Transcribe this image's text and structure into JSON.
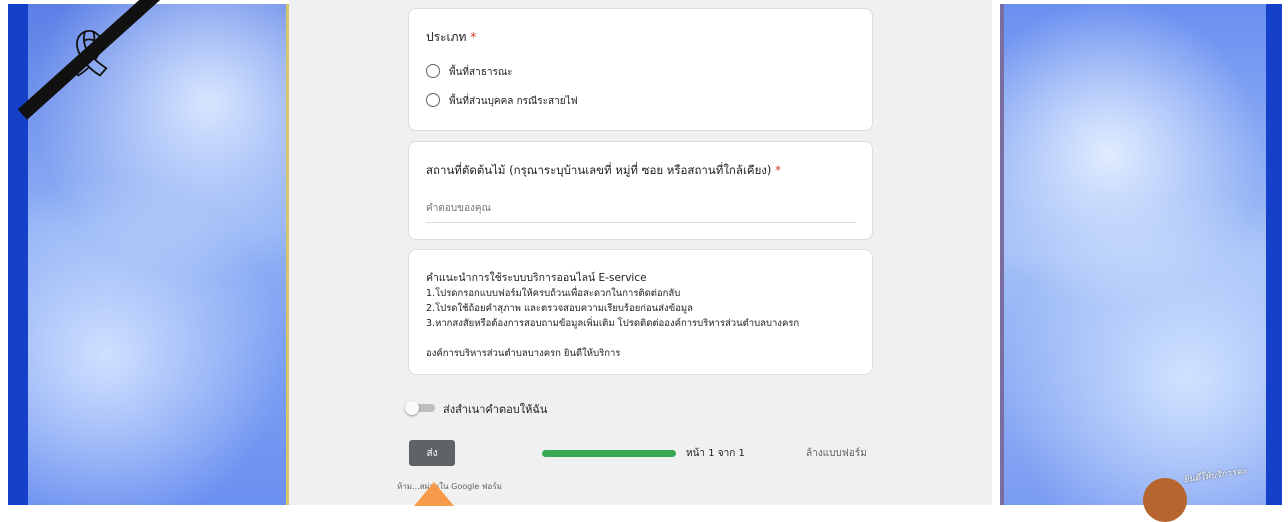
{
  "type_question": {
    "title": "ประเภท",
    "required_mark": "*",
    "options": [
      "พื้นที่สาธารณะ",
      "พื้นที่ส่วนบุคคล กรณีระสายไฟ"
    ]
  },
  "location_question": {
    "title": "สถานที่ตัดต้นไม้ (กรุณาระบุบ้านเลขที่ หมู่ที่ ซอย หรือสถานที่ใกล้เคียง)",
    "required_mark": "*",
    "placeholder": "คำตอบของคุณ"
  },
  "info_card": {
    "title": "คำแนะนำการใช้ระบบบริการออนไลน์ E-service",
    "lines": [
      "1.โปรดกรอกแบบฟอร์มให้ครบถ้วนเพื่อสะดวกในการติดต่อกลับ",
      "2.โปรดใช้ถ้อยคำสุภาพ และตรวจสอบความเรียบร้อยก่อนส่งข้อมูล",
      "3.หากสงสัยหรือต้องการสอบถามข้อมูลเพิ่มเติม โปรดติดต่อองค์การบริหารส่วนตำบลบางครก"
    ],
    "footer": "องค์การบริหารส่วนตำบลบางครก ยินดีให้บริการ"
  },
  "copy_toggle": {
    "label": "ส่งสำเนาคำตอบให้ฉัน",
    "on": false
  },
  "submit_label": "ส่ง",
  "progress": {
    "fraction": 1.0,
    "text": "หน้า 1 จาก 1",
    "color": "#34a853"
  },
  "clear_label": "ล้างแบบฟอร์ม",
  "footer_text": "ห้าม...สผ่านใน Google ฟอร์ม",
  "mascot_text": "ยินดีให้บริการค่ะ",
  "colors": {
    "side_border": "#1540c9",
    "required": "#d93025",
    "button": "#5f6368",
    "arrow": "#f79b4b"
  }
}
